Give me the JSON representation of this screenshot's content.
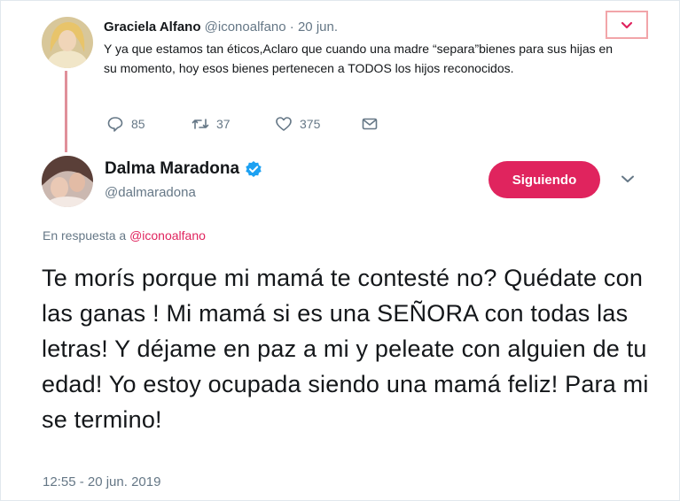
{
  "original_tweet": {
    "display_name": "Graciela Alfano",
    "handle": "@iconoalfano",
    "separator": "·",
    "date": "20 jun.",
    "text": "Y ya que estamos tan éticos,Aclaro que cuando una madre “separa”bienes para sus hijas en su momento, hoy esos bienes pertenecen a TODOS los hijos reconocidos.",
    "actions": {
      "replies": "85",
      "retweets": "37",
      "likes": "375"
    },
    "menu_icon": "chevron-down-icon",
    "avatar_icon": "avatar"
  },
  "reply_tweet": {
    "display_name": "Dalma Maradona",
    "handle": "@dalmaradona",
    "verified_icon": "verified-badge-icon",
    "follow_label": "Siguiendo",
    "reply_prefix": "En respuesta a",
    "reply_to": "@iconoalfano",
    "text": "Te morís porque mi mamá te contesté no? Quédate con las ganas ! Mi mamá si es una SEÑORA con todas las letras! Y déjame en paz a mi y peleate con alguien de tu edad! Yo estoy ocupada siendo una mamá feliz! Para mi se termino!",
    "timestamp": "12:55 - 20 jun. 2019"
  },
  "colors": {
    "accent": "#e0245e",
    "secondary_text": "#657786",
    "verified": "#1da1f2",
    "thread_line": "#e0909a"
  }
}
